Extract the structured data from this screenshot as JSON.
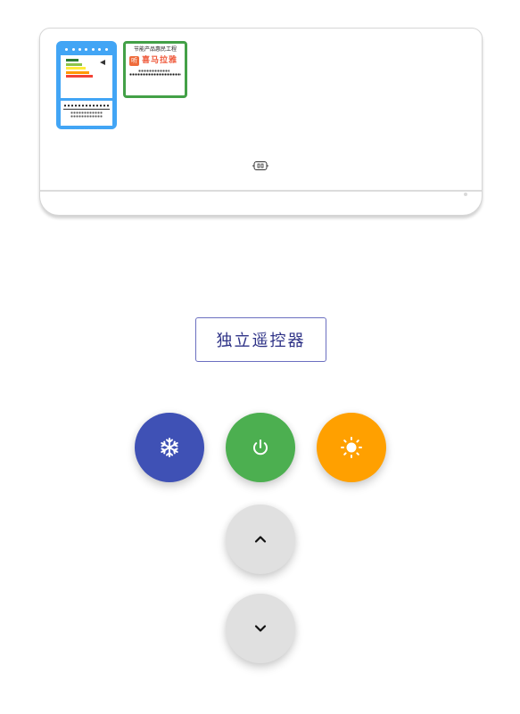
{
  "remote": {
    "label": "独立遥控器"
  },
  "huimin_label": {
    "title": "节能产品惠民工程",
    "brand": "喜马拉雅",
    "logo": "听"
  },
  "controls": {
    "cool": {
      "icon": "snowflake-icon",
      "color": "#3f51b5"
    },
    "power": {
      "icon": "power-icon",
      "color": "#4caf50"
    },
    "heat": {
      "icon": "sun-icon",
      "color": "#ffa000"
    },
    "temp_up": {
      "icon": "chevron-up-icon",
      "color": "#e0e0e0"
    },
    "temp_down": {
      "icon": "chevron-down-icon",
      "color": "#e0e0e0"
    }
  },
  "energy_label": {
    "bar_colors": [
      "#2e7d32",
      "#8bc34a",
      "#ffeb3b",
      "#ff9800",
      "#f44336"
    ],
    "frame_color": "#42a5f5"
  }
}
